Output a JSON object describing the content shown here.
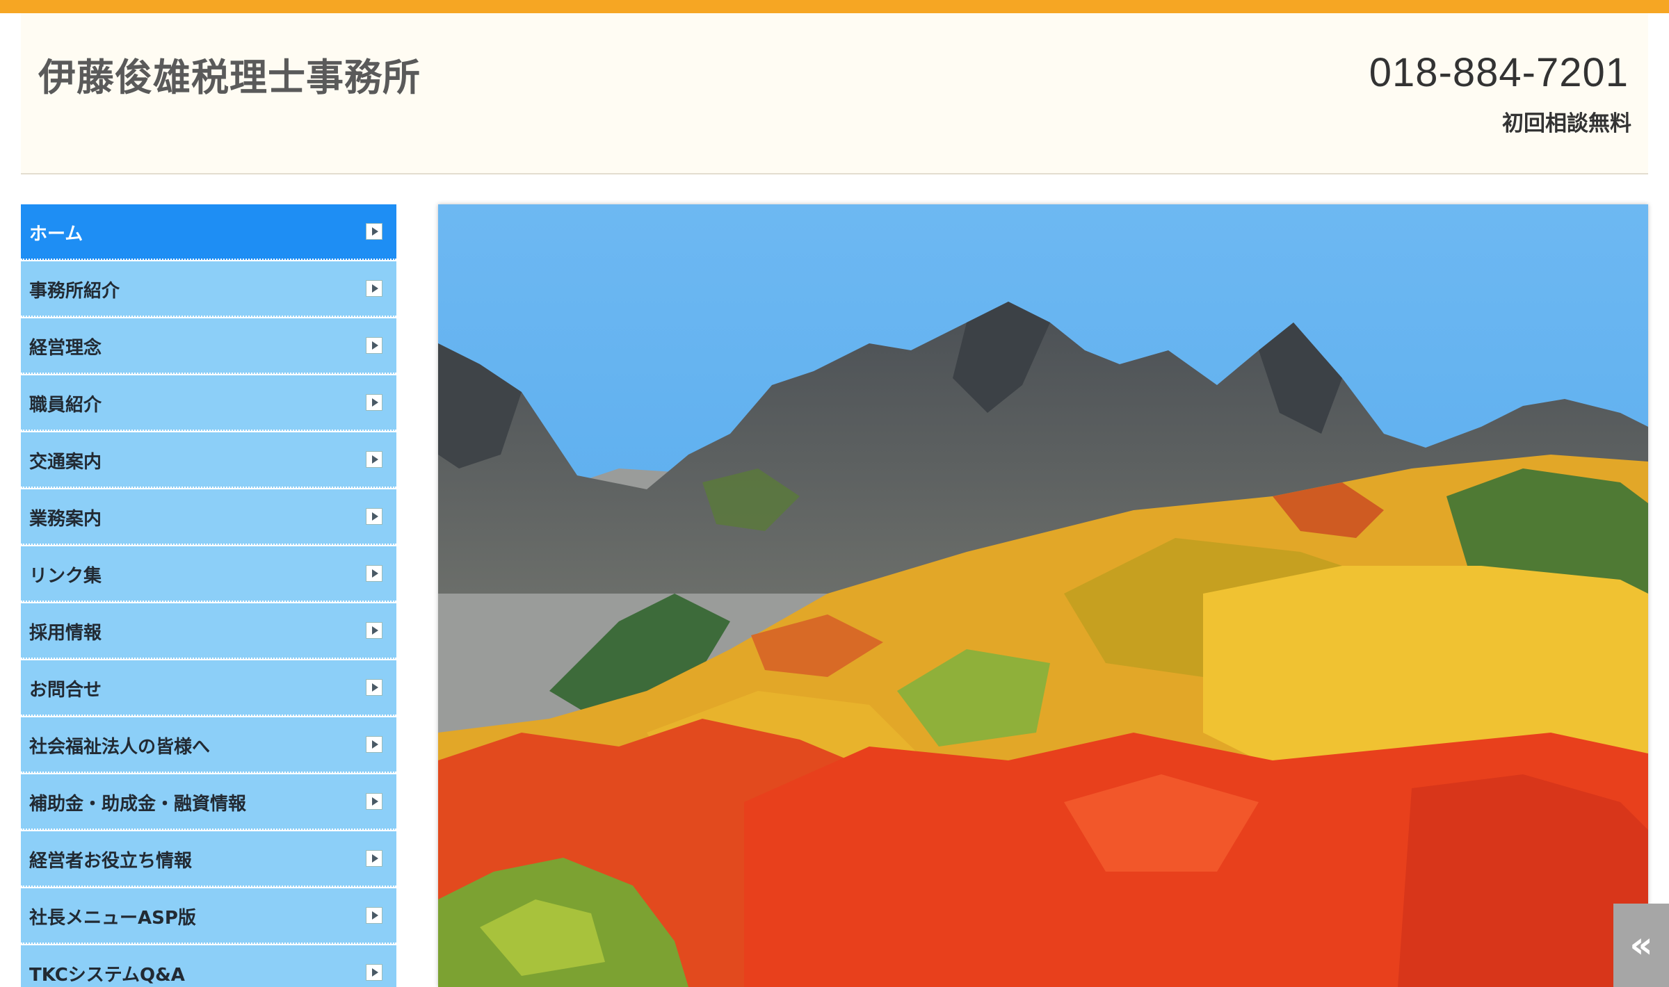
{
  "header": {
    "site_title": "伊藤俊雄税理士事務所",
    "phone": "018-884-7201",
    "phone_note": "初回相談無料"
  },
  "sidebar": {
    "items": [
      {
        "label": "ホーム",
        "active": true
      },
      {
        "label": "事務所紹介"
      },
      {
        "label": "経営理念"
      },
      {
        "label": "職員紹介"
      },
      {
        "label": "交通案内"
      },
      {
        "label": "業務案内"
      },
      {
        "label": "リンク集"
      },
      {
        "label": "採用情報"
      },
      {
        "label": "お問合せ"
      },
      {
        "label": "社会福祉法人の皆様へ"
      },
      {
        "label": "補助金・助成金・融資情報"
      },
      {
        "label": "経営者お役立ち情報"
      },
      {
        "label": "社長メニューASP版"
      },
      {
        "label": "TKCシステムQ&A"
      }
    ]
  },
  "hero": {
    "icon": "mountain-autumn-landscape-image"
  },
  "scroll_toggle": {
    "label": "«"
  },
  "colors": {
    "topbar": "#f6a623",
    "header_bg": "#fffcf3",
    "nav_bg": "#8ccff8",
    "nav_active_bg": "#1e8ef4",
    "sky": "#6db8f2"
  }
}
